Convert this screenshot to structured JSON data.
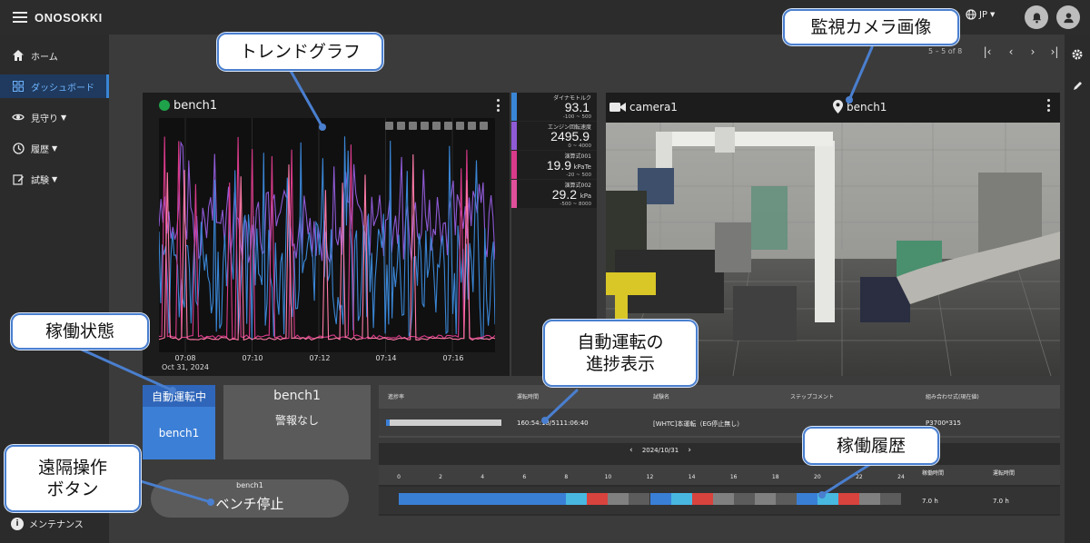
{
  "app": {
    "brand": "ONOSOKKI",
    "language": "JP"
  },
  "sidebar": {
    "items": [
      {
        "label": "ホーム",
        "icon": "home-icon"
      },
      {
        "label": "ダッシュボード",
        "icon": "grid-icon",
        "active": true
      },
      {
        "label": "見守り",
        "icon": "eye-icon",
        "expandable": true
      },
      {
        "label": "履歴",
        "icon": "clock-icon",
        "expandable": true
      },
      {
        "label": "試験",
        "icon": "edit-icon",
        "expandable": true
      }
    ],
    "maintenance": "メンテナンス"
  },
  "pagination": {
    "text": "5 – 5 of 8"
  },
  "trend": {
    "title": "bench1",
    "status_color": "#1fa34a",
    "x_ticks": [
      "07:08",
      "07:10",
      "07:12",
      "07:14",
      "07:16"
    ],
    "x_date": "Oct 31, 2024"
  },
  "gauges": [
    {
      "label": "ダイナモトルク",
      "value": "93.1",
      "unit": "",
      "range": "-100 ~ 500",
      "color": "#3a86d6"
    },
    {
      "label": "エンジン回転速度",
      "value": "2495.9",
      "unit": "",
      "range": "0 ~ 4000",
      "color": "#8f5ad6"
    },
    {
      "label": "演算式001",
      "value": "19.9",
      "unit": "kPaTe",
      "range": "-20 ~ 500",
      "color": "#d93a8a"
    },
    {
      "label": "演算式002",
      "value": "29.2",
      "unit": "kPa",
      "range": "-500 ~ 8000",
      "color": "#e04f9a"
    }
  ],
  "camera": {
    "name": "camera1",
    "bench": "bench1"
  },
  "operation": {
    "head": "自動運転中",
    "bench": "bench1"
  },
  "alarm": {
    "bench": "bench1",
    "text": "警報なし"
  },
  "progress": {
    "headers": [
      "進捗率",
      "運転時間",
      "試験名",
      "ステップコメント",
      "組み合わせ式(現在値)"
    ],
    "fill_fraction": 0.03,
    "time": "160:54:18/5111:06:40",
    "test_name": "[WHTC]本運転（EG停止無し）",
    "step_comment": "",
    "formula": "P3700*315"
  },
  "history": {
    "date": "2024/10/31",
    "prev": "‹",
    "next": "›",
    "ticks": [
      "0",
      "2",
      "4",
      "6",
      "8",
      "10",
      "12",
      "14",
      "16",
      "18",
      "20",
      "22",
      "24"
    ],
    "col_uptime": "稼働時間",
    "col_runtime": "運転時間",
    "uptime": "7.0 h",
    "runtime": "7.0 h"
  },
  "stop_button": {
    "sub": "bench1",
    "label": "ベンチ停止"
  },
  "callouts": {
    "trend": "トレンドグラフ",
    "camera": "監視カメラ画像",
    "state": "稼働状態",
    "auto": "自動運転の\n進捗表示",
    "history": "稼働履歴",
    "remote": "遠隔操作\nボタン"
  }
}
